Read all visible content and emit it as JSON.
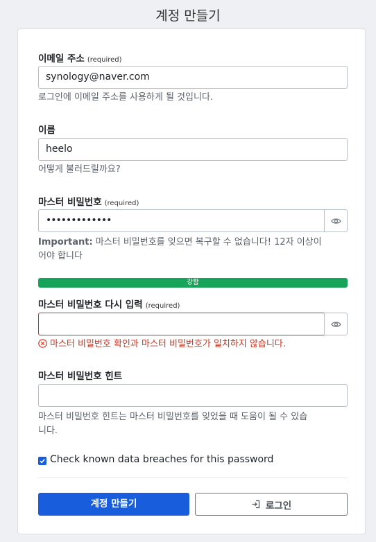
{
  "page": {
    "title": "계정 만들기"
  },
  "fields": {
    "email": {
      "label": "이메일 주소",
      "required": "(required)",
      "value": "synology@naver.com",
      "help": "로그인에 이메일 주소를 사용하게 될 것입니다."
    },
    "name": {
      "label": "이름",
      "value": "heelo",
      "help": "어떻게 불러드릴까요?"
    },
    "master_password": {
      "label": "마스터 비밀번호",
      "required": "(required)",
      "value": "•••••••••••••",
      "help_strong": "Important:",
      "help_line1": " 마스터 비밀번호를 잊으면 복구할 수 없습니다! 12자 이상이",
      "help_line2": "어야 합니다",
      "strength_label": "강함",
      "strength_level": 1.0
    },
    "confirm_password": {
      "label": "마스터 비밀번호 다시 입력",
      "required": "(required)",
      "value": "",
      "error": "마스터 비밀번호 확인과 마스터 비밀번호가 일치하지 않습니다."
    },
    "hint": {
      "label": "마스터 비밀번호 힌트",
      "value": "",
      "help_line1": "마스터 비밀번호 힌트는 마스터 비밀번호를 잊었을 때 도움이 될 수 있습",
      "help_line2": "니다."
    }
  },
  "breach_check": {
    "checked": true,
    "label": "Check known data breaches for this password"
  },
  "buttons": {
    "create": "계정 만들기",
    "login": "로그인"
  },
  "colors": {
    "primary": "#175ddc",
    "strength": "#17a35a",
    "error": "#c83522"
  },
  "icons": {
    "toggle_visibility": "eye-icon",
    "error": "error-circle-icon",
    "login": "sign-in-icon",
    "checkbox": "check-icon"
  }
}
